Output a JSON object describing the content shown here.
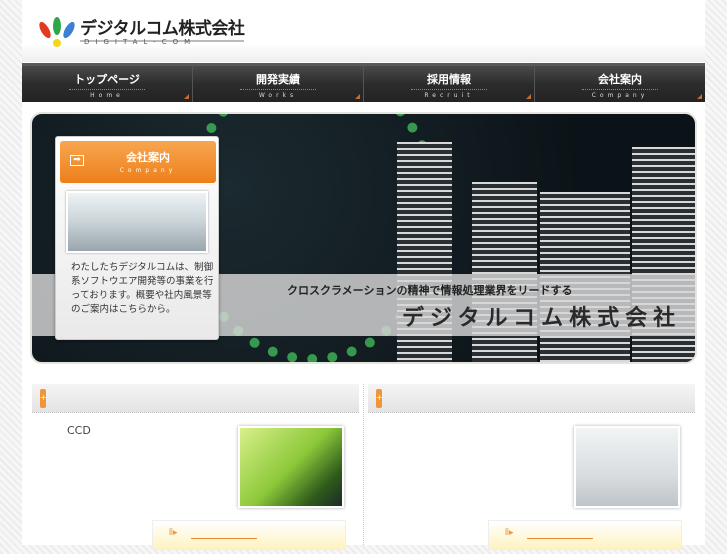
{
  "header": {
    "logo_jp": "デジタルコム株式会社",
    "logo_en": "DIGITAL-COM"
  },
  "nav": [
    {
      "jp": "トップページ",
      "en": "Home"
    },
    {
      "jp": "開発実績",
      "en": "Works"
    },
    {
      "jp": "採用情報",
      "en": "Recruit"
    },
    {
      "jp": "会社案内",
      "en": "Company"
    }
  ],
  "hero": {
    "tagline": "クロスクラメーションの精神で情報処理業界をリードする",
    "company": "デジタルコム株式会社",
    "card": {
      "title_jp": "会社案内",
      "title_en": "Company",
      "arrow": "➡",
      "text": "わたしたちデジタルコムは、制御系ソフトウエア開発等の事業を行っております。概要や社内風景等のご案内はこちらから。"
    }
  },
  "columns": [
    {
      "tab_icon": "+",
      "text": "CCD",
      "more_icon": "⦀▸"
    },
    {
      "tab_icon": "+",
      "text": "",
      "more_icon": "⦀▸"
    }
  ]
}
